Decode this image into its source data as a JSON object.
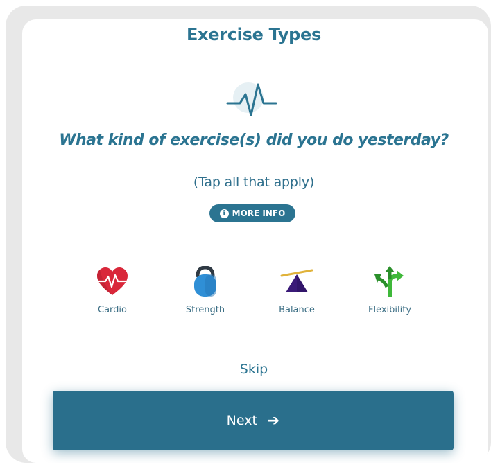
{
  "header": {
    "title": "Exercise Types"
  },
  "question": {
    "text": "What kind of exercise(s) did you do yesterday?",
    "instruction": "(Tap all that apply)",
    "more_info_label": "MORE INFO",
    "icon": "pulse-icon"
  },
  "exercise_types": [
    {
      "label": "Cardio",
      "icon": "heart-icon",
      "color": "#d9273a"
    },
    {
      "label": "Strength",
      "icon": "kettlebell-icon",
      "color": "#2f8fd6"
    },
    {
      "label": "Balance",
      "icon": "seesaw-icon",
      "color": "#3a1a78"
    },
    {
      "label": "Flexibility",
      "icon": "flexibility-arrows-icon",
      "color": "#3fb83a"
    }
  ],
  "actions": {
    "skip_label": "Skip",
    "next_label": "Next",
    "next_icon": "arrow-right-icon"
  },
  "colors": {
    "accent": "#2b7491",
    "button": "#2a6f8c",
    "frame": "#e8e8e8"
  }
}
